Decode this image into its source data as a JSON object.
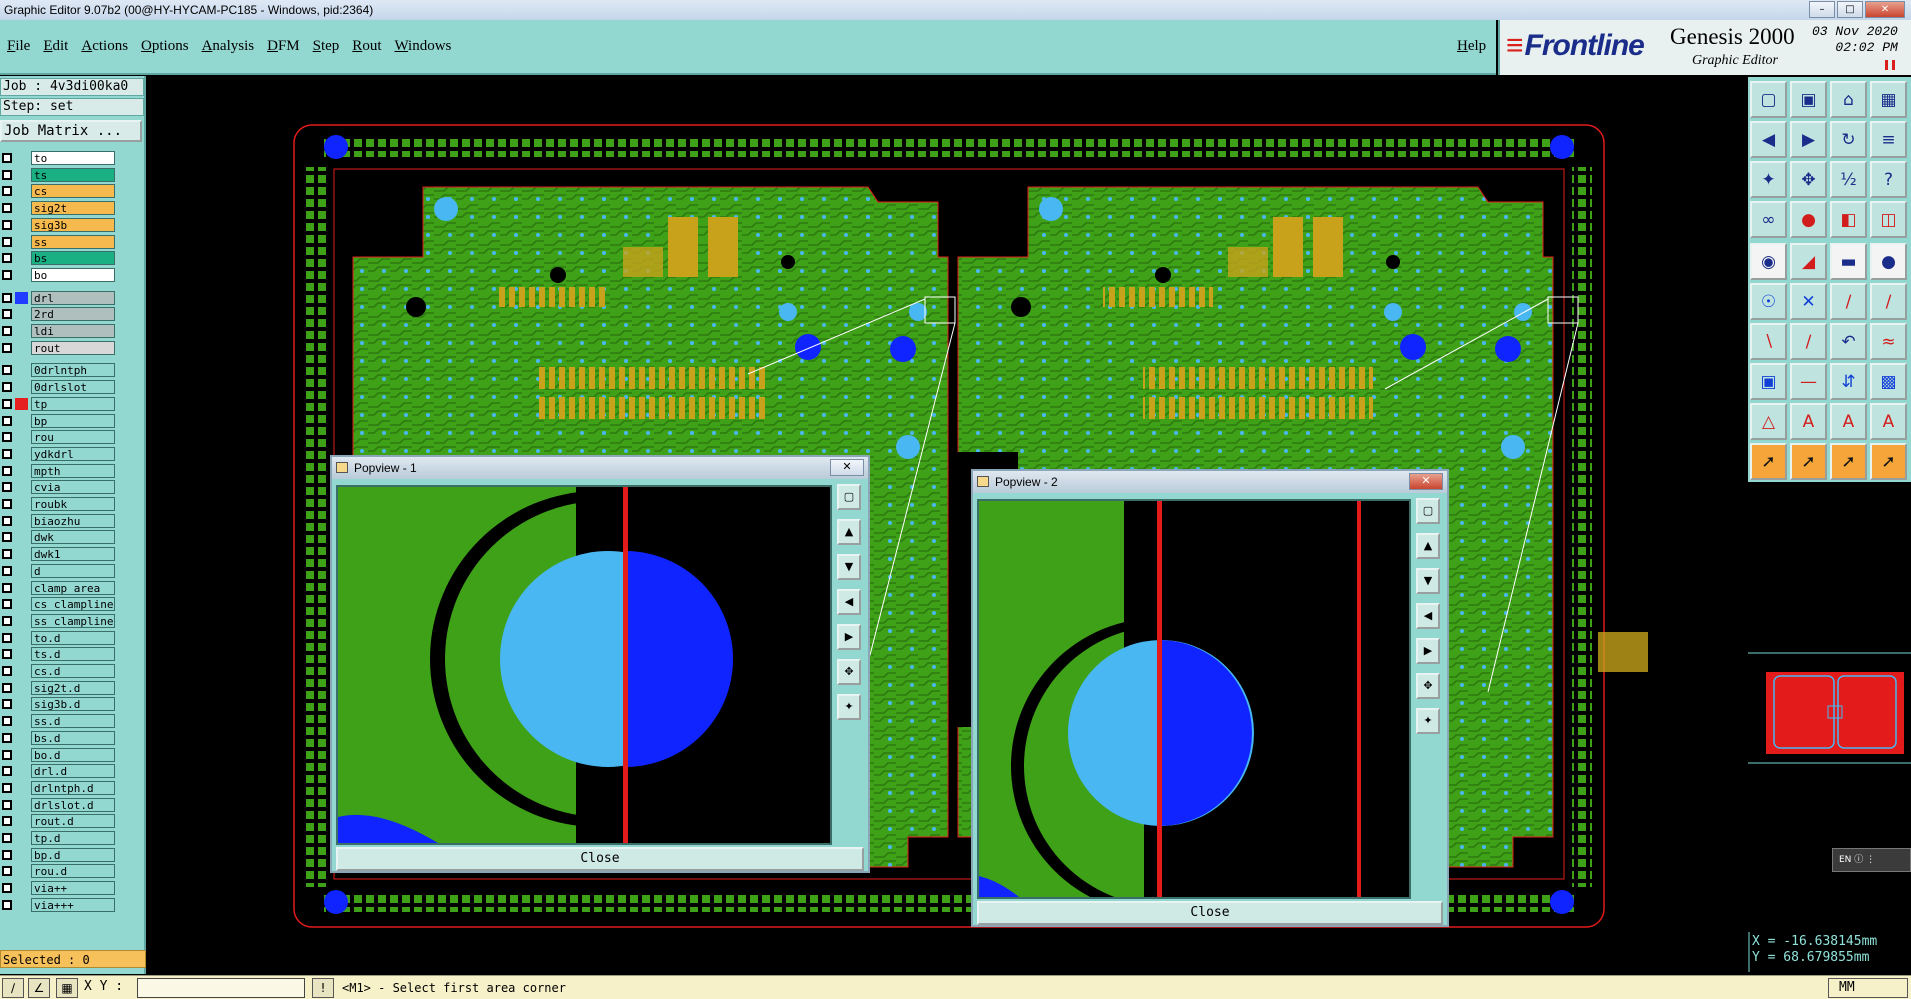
{
  "window": {
    "title": "Graphic Editor 9.07b2 (00@HY-HYCAM-PC185 - Windows, pid:2364)"
  },
  "menu": {
    "items": [
      {
        "label": "File"
      },
      {
        "label": "Edit"
      },
      {
        "label": "Actions"
      },
      {
        "label": "Options"
      },
      {
        "label": "Analysis"
      },
      {
        "label": "DFM"
      },
      {
        "label": "Step"
      },
      {
        "label": "Rout"
      },
      {
        "label": "Windows"
      }
    ],
    "help": "Help"
  },
  "brand": {
    "logo": "Frontline",
    "product": "Genesis 2000",
    "product_sub": "Graphic Editor",
    "date": "03 Nov 2020",
    "time": "02:02 PM"
  },
  "panel": {
    "job": "Job : 4v3di00ka0",
    "step": "Step: set",
    "job_matrix": "Job Matrix ...",
    "selected": "Selected : 0"
  },
  "layers": [
    {
      "name": "to",
      "color": "#ffffff"
    },
    {
      "name": "ts",
      "color": "#1bb083"
    },
    {
      "name": "cs",
      "color": "#f6b94e"
    },
    {
      "name": "sig2t",
      "color": "#f6b94e"
    },
    {
      "name": "sig3b",
      "color": "#f6b94e"
    },
    {
      "name": "ss",
      "color": "#f6b94e"
    },
    {
      "name": "bs",
      "color": "#1bb083"
    },
    {
      "name": "bo",
      "color": "#ffffff"
    },
    {
      "name": "drl",
      "color": "#aebfbd",
      "swatch": "#1f3cff"
    },
    {
      "name": "2rd",
      "color": "#aebfbd"
    },
    {
      "name": "ldi",
      "color": "#aebfbd"
    },
    {
      "name": "rout",
      "color": "#d8d8d8"
    },
    {
      "name": "0drlntph",
      "color": "#93d7d1"
    },
    {
      "name": "0drlslot",
      "color": "#93d7d1"
    },
    {
      "name": "tp",
      "color": "#93d7d1",
      "swatch": "#e62020",
      "active": true
    },
    {
      "name": "bp",
      "color": "#93d7d1"
    },
    {
      "name": "rou",
      "color": "#93d7d1"
    },
    {
      "name": "ydkdrl",
      "color": "#93d7d1"
    },
    {
      "name": "mpth",
      "color": "#93d7d1"
    },
    {
      "name": "cvia",
      "color": "#93d7d1"
    },
    {
      "name": "roubk",
      "color": "#93d7d1"
    },
    {
      "name": "biaozhu",
      "color": "#93d7d1"
    },
    {
      "name": "dwk",
      "color": "#93d7d1"
    },
    {
      "name": "dwk1",
      "color": "#93d7d1"
    },
    {
      "name": "d",
      "color": "#93d7d1"
    },
    {
      "name": "clamp_area",
      "color": "#93d7d1"
    },
    {
      "name": "cs_clampline",
      "color": "#93d7d1"
    },
    {
      "name": "ss_clampline",
      "color": "#93d7d1"
    },
    {
      "name": "to.d",
      "color": "#93d7d1"
    },
    {
      "name": "ts.d",
      "color": "#93d7d1"
    },
    {
      "name": "cs.d",
      "color": "#93d7d1"
    },
    {
      "name": "sig2t.d",
      "color": "#93d7d1"
    },
    {
      "name": "sig3b.d",
      "color": "#93d7d1"
    },
    {
      "name": "ss.d",
      "color": "#93d7d1"
    },
    {
      "name": "bs.d",
      "color": "#93d7d1"
    },
    {
      "name": "bo.d",
      "color": "#93d7d1"
    },
    {
      "name": "drl.d",
      "color": "#93d7d1"
    },
    {
      "name": "drlntph.d",
      "color": "#93d7d1"
    },
    {
      "name": "drlslot.d",
      "color": "#93d7d1"
    },
    {
      "name": "rout.d",
      "color": "#93d7d1"
    },
    {
      "name": "tp.d",
      "color": "#93d7d1"
    },
    {
      "name": "bp.d",
      "color": "#93d7d1"
    },
    {
      "name": "rou.d",
      "color": "#93d7d1"
    },
    {
      "name": "via++",
      "color": "#93d7d1"
    },
    {
      "name": "via+++",
      "color": "#93d7d1"
    }
  ],
  "popviews": [
    {
      "title": "Popview - 1",
      "close_label": "Close"
    },
    {
      "title": "Popview - 2",
      "close_label": "Close"
    }
  ],
  "coords": {
    "x": "X = -16.638145mm",
    "y": "Y =  68.679855mm"
  },
  "lang": "EN",
  "status": {
    "xy_label": "X Y :",
    "xy_value": "",
    "message": "<M1> - Select first area corner",
    "units": "MM"
  },
  "colors": {
    "pcb_green": "#3fa118",
    "copper_gold": "#c7a21a",
    "pad_light_blue": "#48b7f2",
    "drill_blue": "#1024ff",
    "route_red": "#e31b1b",
    "panel_teal": "#93d7d1"
  }
}
